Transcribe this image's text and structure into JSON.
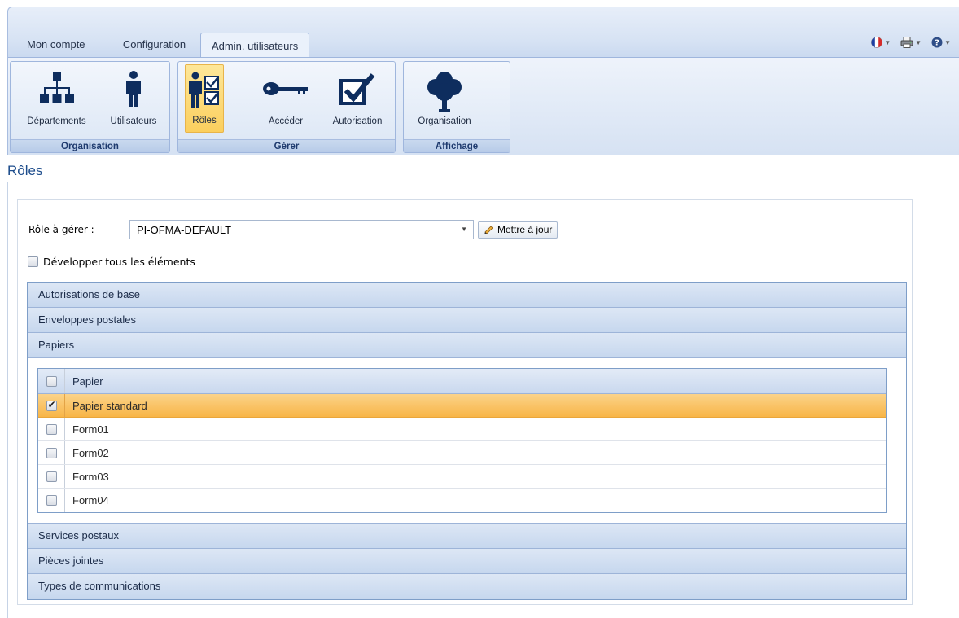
{
  "tabs": [
    {
      "label": "Mon compte"
    },
    {
      "label": "Configuration"
    },
    {
      "label": "Admin. utilisateurs"
    }
  ],
  "ribbon": {
    "groups": [
      {
        "label": "Organisation",
        "buttons": [
          {
            "label": "Départements",
            "icon": "org-chart-icon"
          },
          {
            "label": "Utilisateurs",
            "icon": "user-icon"
          }
        ]
      },
      {
        "label": "Gérer",
        "buttons": [
          {
            "label": "Rôles",
            "icon": "user-checklist-icon"
          },
          {
            "label": "Accéder",
            "icon": "key-icon"
          },
          {
            "label": "Autorisation",
            "icon": "checkbox-check-icon"
          }
        ]
      },
      {
        "label": "Affichage",
        "buttons": [
          {
            "label": "Organisation",
            "icon": "tree-icon"
          }
        ]
      }
    ]
  },
  "page": {
    "title": "Rôles"
  },
  "role": {
    "label": "Rôle à gérer :",
    "selected": "PI-OFMA-DEFAULT",
    "update_label": "Mettre à jour"
  },
  "expand_all": {
    "label": "Développer tous les éléments",
    "checked": false
  },
  "sections": [
    {
      "label": "Autorisations de base"
    },
    {
      "label": "Enveloppes postales"
    },
    {
      "label": "Papiers"
    },
    {
      "label": "Services postaux"
    },
    {
      "label": "Pièces jointes"
    },
    {
      "label": "Types de communications"
    }
  ],
  "papers_grid": {
    "header": "Papier",
    "rows": [
      {
        "label": "Papier standard",
        "checked": true
      },
      {
        "label": "Form01",
        "checked": false
      },
      {
        "label": "Form02",
        "checked": false
      },
      {
        "label": "Form03",
        "checked": false
      },
      {
        "label": "Form04",
        "checked": false
      }
    ]
  },
  "colors": {
    "accent": "#1e4d8c",
    "selected_row": "#f8b547",
    "ribbon": "#cbdaf0"
  }
}
